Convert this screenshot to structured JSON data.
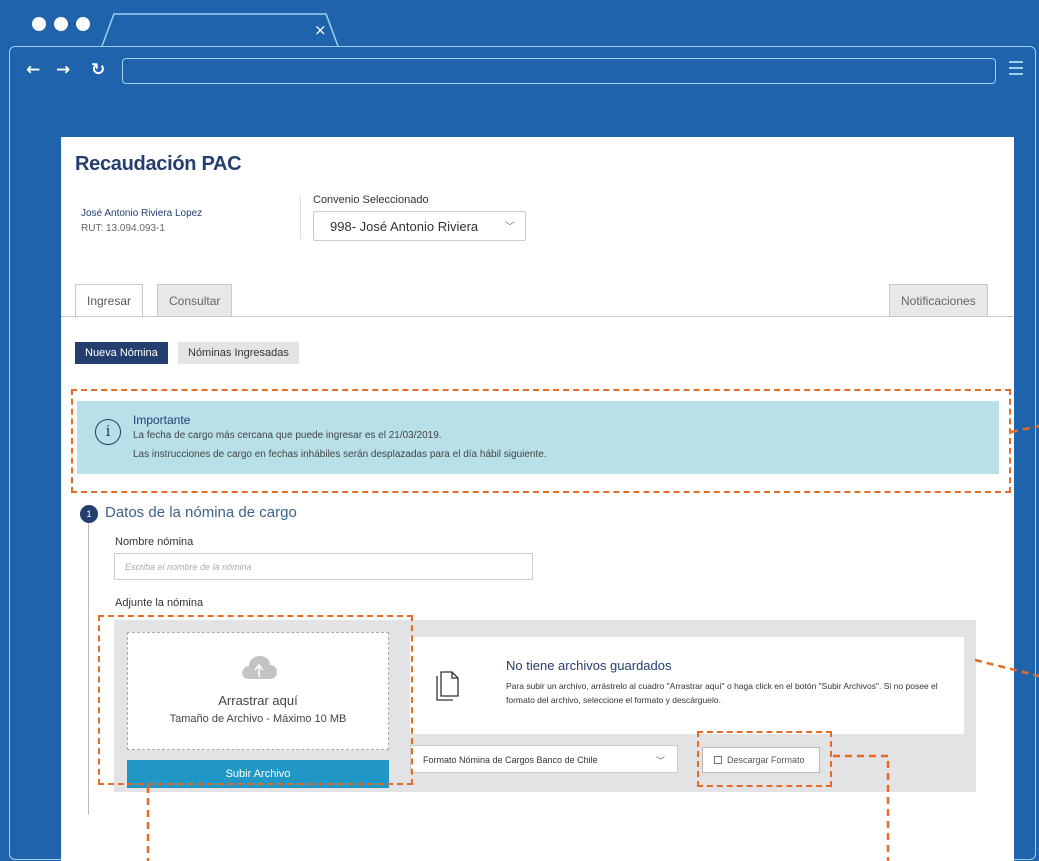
{
  "browser": {
    "close_glyph": "×"
  },
  "page": {
    "title": "Recaudación PAC",
    "user": {
      "name": "José Antonio Riviera Lopez",
      "rut": "RUT: 13.094.093-1"
    },
    "convenio": {
      "label": "Convenio Seleccionado",
      "value": "998- José Antonio Riviera"
    },
    "tabs": [
      {
        "label": "Ingresar"
      },
      {
        "label": "Consultar"
      }
    ],
    "notifications_tab": "Notificaciones",
    "subtabs": [
      {
        "label": "Nueva Nómina"
      },
      {
        "label": "Nóminas Ingresadas"
      }
    ],
    "alert": {
      "title": "Importante",
      "line1": "La fecha de cargo más cercana que puede ingresar es el 21/03/2019.",
      "line2": "Las instrucciones de cargo en fechas inhábiles serán desplazadas para el día hábil siguiente."
    },
    "step": {
      "number": "1",
      "title": "Datos de la nómina de cargo",
      "name_label": "Nombre nómina",
      "name_placeholder": "Escriba el nombre de la nómina",
      "attach_label": "Adjunte la nómina"
    },
    "upload": {
      "drop_title": "Arrastrar aquí",
      "drop_subtitle": "Tamaño de Archivo - Máximo 10 MB",
      "upload_button": "Subir Archivo",
      "empty_title": "No tiene archivos guardados",
      "empty_body": "Para subir un archivo, arrástrelo al cuadro \"Arrastrar aquí\" o haga click en el botón \"Subir Archivos\". Si no posee el formato del archivo, seleccione el formato y descárguelo.",
      "format_select": "Formato Nómina de Cargos Banco de Chile",
      "download_button": "Descargar Formato"
    }
  },
  "colors": {
    "background": "#2063ad",
    "primary": "#243e70",
    "accent": "#2197c6",
    "annotation": "#e66c25",
    "alert_bg": "#b8e0e8"
  },
  "icons": [
    "back-arrow-icon",
    "forward-arrow-icon",
    "reload-icon",
    "menu-icon",
    "chevron-down-icon",
    "info-icon",
    "cloud-upload-icon",
    "documents-icon",
    "download-icon"
  ]
}
